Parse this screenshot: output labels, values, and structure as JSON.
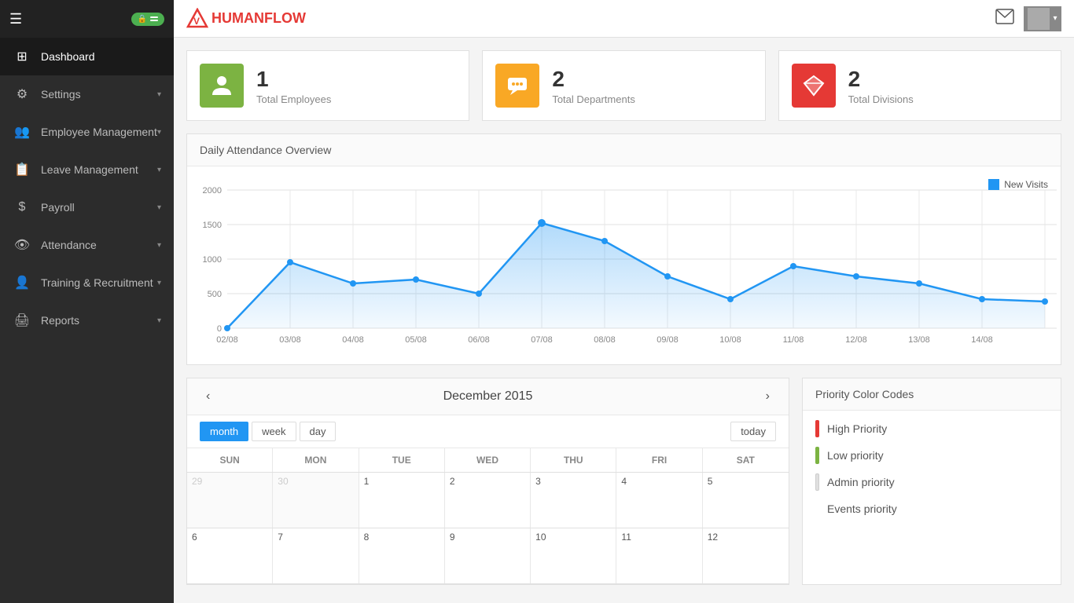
{
  "sidebar": {
    "items": [
      {
        "label": "Dashboard",
        "icon": "⊞",
        "active": true,
        "hasChevron": false
      },
      {
        "label": "Settings",
        "icon": "⚙",
        "active": false,
        "hasChevron": true
      },
      {
        "label": "Employee Management",
        "icon": "👥",
        "active": false,
        "hasChevron": true
      },
      {
        "label": "Leave Management",
        "icon": "📋",
        "active": false,
        "hasChevron": true
      },
      {
        "label": "Payroll",
        "icon": "$",
        "active": false,
        "hasChevron": true
      },
      {
        "label": "Attendance",
        "icon": "👁",
        "active": false,
        "hasChevron": true
      },
      {
        "label": "Training & Recruitment",
        "icon": "👤",
        "active": false,
        "hasChevron": true
      },
      {
        "label": "Reports",
        "icon": "🖨",
        "active": false,
        "hasChevron": true
      }
    ]
  },
  "header": {
    "logo_v": "V",
    "logo_name": "HUMANFLOW"
  },
  "stats": [
    {
      "number": "1",
      "label": "Total Employees",
      "icon": "👤",
      "color": "green"
    },
    {
      "number": "2",
      "label": "Total Departments",
      "icon": "💬",
      "color": "yellow"
    },
    {
      "number": "2",
      "label": "Total Divisions",
      "icon": "💎",
      "color": "red"
    }
  ],
  "chart": {
    "title": "Daily Attendance Overview",
    "legend": "New Visits",
    "yLabels": [
      "2000",
      "1500",
      "1000",
      "500",
      "0"
    ],
    "xLabels": [
      "02/08",
      "03/08",
      "04/08",
      "05/08",
      "06/08",
      "07/08",
      "08/08",
      "09/08",
      "10/08",
      "11/08",
      "12/08",
      "13/08",
      "14/08"
    ]
  },
  "calendar": {
    "title": "December 2015",
    "viewBtns": [
      "month",
      "week",
      "day"
    ],
    "activeView": "month",
    "todayLabel": "today",
    "dayNames": [
      "SUN",
      "MON",
      "TUE",
      "WED",
      "THU",
      "FRI",
      "SAT"
    ],
    "weeks": [
      [
        {
          "num": "29",
          "other": true,
          "events": []
        },
        {
          "num": "30",
          "other": true,
          "events": []
        },
        {
          "num": "1",
          "other": false,
          "events": []
        },
        {
          "num": "2",
          "other": false,
          "events": []
        },
        {
          "num": "3",
          "other": false,
          "events": []
        },
        {
          "num": "4",
          "other": false,
          "events": []
        },
        {
          "num": "5",
          "other": false,
          "events": []
        }
      ],
      [
        {
          "num": "6",
          "other": false,
          "events": []
        },
        {
          "num": "7",
          "other": false,
          "events": []
        },
        {
          "num": "8",
          "other": false,
          "events": []
        },
        {
          "num": "9",
          "other": false,
          "events": []
        },
        {
          "num": "10",
          "other": false,
          "events": []
        },
        {
          "num": "11",
          "other": false,
          "events": []
        },
        {
          "num": "12",
          "other": false,
          "events": []
        }
      ]
    ]
  },
  "priority": {
    "title": "Priority Color Codes",
    "items": [
      {
        "label": "High Priority",
        "color": "red"
      },
      {
        "label": "Low priority",
        "color": "green"
      },
      {
        "label": "Admin priority",
        "color": "white"
      },
      {
        "label": "Events priority",
        "color": "none"
      }
    ]
  }
}
